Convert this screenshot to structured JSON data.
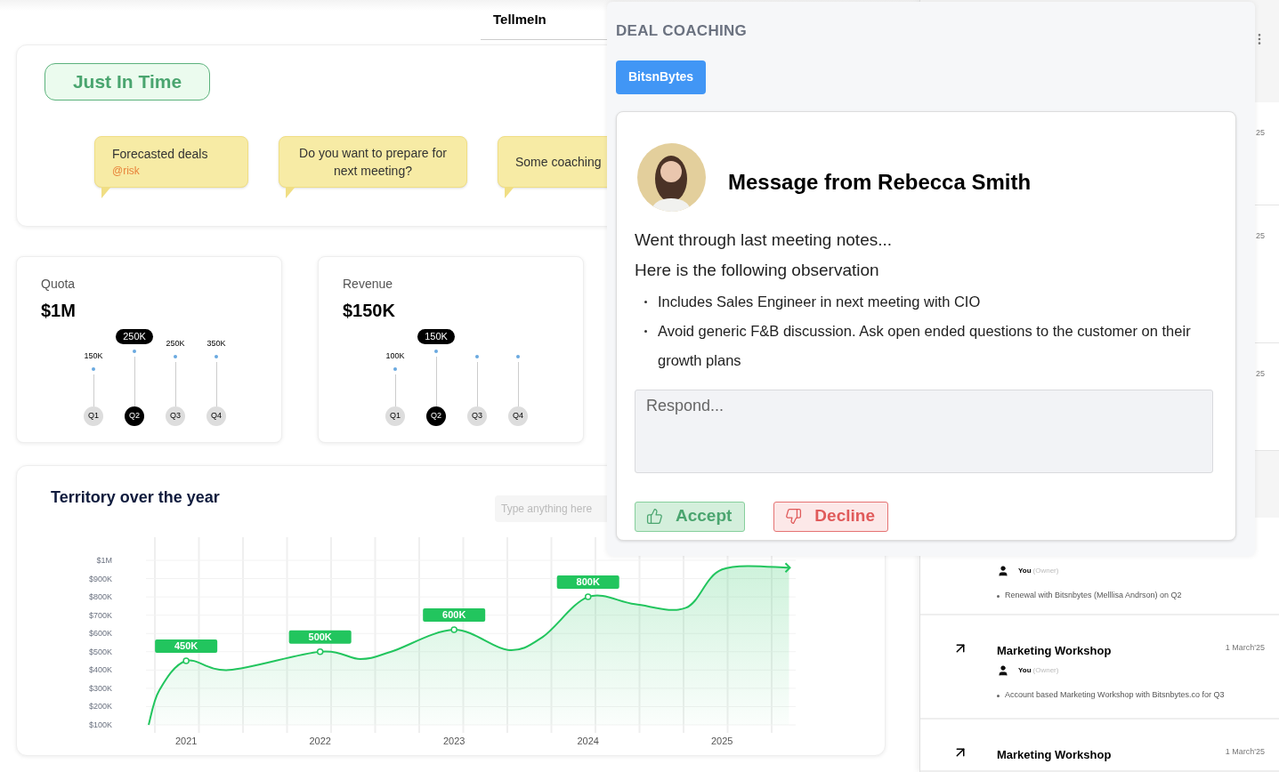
{
  "header": {
    "tab": "TellmeIn"
  },
  "jit": {
    "badge": "Just In Time",
    "bubbles": [
      {
        "text": "Forecasted deals",
        "tag": "@risk"
      },
      {
        "text": "Do you want to prepare for next meeting?"
      },
      {
        "text": "Some coaching"
      }
    ]
  },
  "metrics": [
    {
      "title": "Quota",
      "value": "$1M",
      "quarters": [
        {
          "label": "Q1",
          "value": "150K",
          "selected": false
        },
        {
          "label": "Q2",
          "value": "250K",
          "selected": true
        },
        {
          "label": "Q3",
          "value": "250K",
          "selected": false
        },
        {
          "label": "Q4",
          "value": "350K",
          "selected": false
        }
      ]
    },
    {
      "title": "Revenue",
      "value": "$150K",
      "quarters": [
        {
          "label": "Q1",
          "value": "100K",
          "selected": false
        },
        {
          "label": "Q2",
          "value": "150K",
          "selected": true
        },
        {
          "label": "Q3",
          "selected": false
        },
        {
          "label": "Q4",
          "selected": false
        }
      ]
    }
  ],
  "territory": {
    "title": "Territory over the year",
    "search": {
      "placeholder": "Type anything here"
    },
    "chart_data": {
      "type": "area",
      "grid": true,
      "x": [
        2020.72,
        2020.8,
        2021,
        2021.32,
        2022,
        2022.3,
        2022.53,
        2023,
        2023.4,
        2023.66,
        2024,
        2024.35,
        2024.73,
        2025,
        2025.5
      ],
      "series": [
        {
          "color": "#22c55e",
          "values": [
            100000,
            290000,
            450000,
            400000,
            500000,
            460000,
            500000,
            620000,
            510000,
            580000,
            800000,
            760000,
            740000,
            950000,
            960000
          ]
        }
      ],
      "xlim": [
        2020.7,
        2025.55
      ],
      "xticks": [
        2021,
        2022,
        2023,
        2024,
        2025
      ],
      "yticks": [
        {
          "value": 100000,
          "label": "$100K"
        },
        {
          "value": 200000,
          "label": "$200K"
        },
        {
          "value": 300000,
          "label": "$300K"
        },
        {
          "value": 400000,
          "label": "$400K"
        },
        {
          "value": 500000,
          "label": "$500K"
        },
        {
          "value": 600000,
          "label": "$600K"
        },
        {
          "value": 700000,
          "label": "$700K"
        },
        {
          "value": 800000,
          "label": "$800K"
        },
        {
          "value": 900000,
          "label": "$900K"
        },
        {
          "value": 1000000,
          "label": "$1M"
        }
      ],
      "ylim": [
        100000,
        1000000
      ],
      "annotations": [
        {
          "x": 2021,
          "y": 450000,
          "text": "450K"
        },
        {
          "x": 2022,
          "y": 500000,
          "text": "500K"
        },
        {
          "x": 2023,
          "y": 620000,
          "text": "600K"
        },
        {
          "x": 2024,
          "y": 800000,
          "text": "800K"
        }
      ]
    }
  },
  "activity": {
    "rows": [
      {
        "kind": "hidden",
        "date": "25"
      },
      {
        "kind": "hidden",
        "date": "25"
      },
      {
        "kind": "hidden",
        "date": "25"
      },
      {
        "kind": "item",
        "owner": "You",
        "role": "(Owner)",
        "note": "Renewal with Bitsnbytes (Melllisa Andrson) on Q2"
      },
      {
        "kind": "item",
        "title": "Marketing Workshop",
        "date": "1 March'25",
        "owner": "You",
        "role": "(Owner)",
        "note": "Account based Marketing Workshop with Bitsnbytes.co for Q3"
      },
      {
        "kind": "item",
        "title": "Marketing Workshop",
        "date": "1 March'25"
      }
    ]
  },
  "coaching": {
    "title": "DEAL COACHING",
    "account": "BitsnBytes",
    "message": {
      "heading": "Message from Rebecca Smith",
      "lead": "Went through last meeting notes...",
      "intro": "Here is the following observation",
      "bullets": [
        "Includes Sales Engineer in next meeting with CIO",
        "Avoid generic F&B discussion. Ask open ended questions to the customer on their growth plans"
      ],
      "reply": {
        "placeholder": "Respond..."
      },
      "actions": [
        {
          "kind": "accept",
          "label": "Accept"
        },
        {
          "kind": "decline",
          "label": "Decline"
        }
      ]
    }
  }
}
